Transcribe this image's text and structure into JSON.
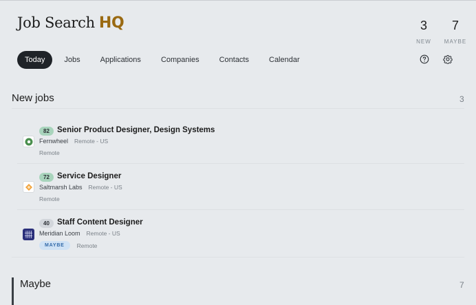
{
  "app": {
    "logo_text": "Job Search",
    "logo_accent": "HQ"
  },
  "stats": [
    {
      "value": "3",
      "label": "NEW"
    },
    {
      "value": "7",
      "label": "MAYBE"
    }
  ],
  "nav": {
    "tabs": [
      {
        "label": "Today",
        "active": true
      },
      {
        "label": "Jobs"
      },
      {
        "label": "Applications"
      },
      {
        "label": "Companies"
      },
      {
        "label": "Contacts"
      },
      {
        "label": "Calendar"
      }
    ],
    "help_icon": "help-circle-icon",
    "settings_icon": "gear-icon"
  },
  "sections": {
    "new_jobs": {
      "title": "New jobs",
      "count": "3",
      "items": [
        {
          "score": "82",
          "title": "Senior Product Designer, Design Systems",
          "company": "Fernwheel",
          "location": "Remote - US",
          "tags": [
            "Remote"
          ],
          "badge": "",
          "logo_icon": "fernwheel-logo-icon"
        },
        {
          "score": "72",
          "title": "Service Designer",
          "company": "Saltmarsh Labs",
          "location": "Remote - US",
          "tags": [
            "Remote"
          ],
          "badge": "",
          "logo_icon": "saltmarsh-logo-icon"
        },
        {
          "score": "40",
          "title": "Staff Content Designer",
          "company": "Meridian Loom",
          "location": "Remote - US",
          "tags": [
            "Remote"
          ],
          "badge": "MAYBE",
          "logo_icon": "meridian-loom-logo-icon"
        }
      ]
    },
    "maybe": {
      "title": "Maybe",
      "count": "7"
    }
  },
  "colors": {
    "background": "#e7eaed",
    "accent": "#9a6a12",
    "score_high": "#a8d4bc",
    "score_low": "#d2d6db",
    "badge_maybe": "#cfe2f5"
  }
}
